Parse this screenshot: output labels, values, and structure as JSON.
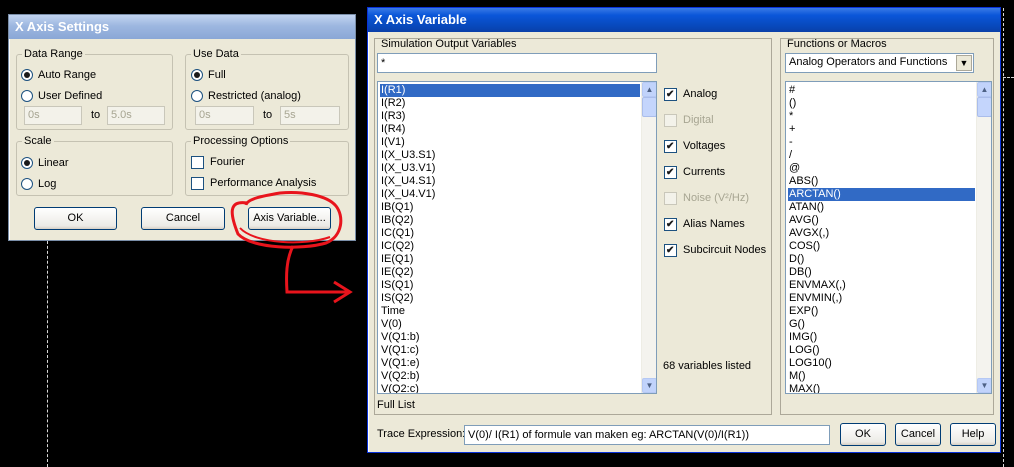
{
  "axis_settings": {
    "title": "X Axis Settings",
    "data_range": {
      "legend": "Data Range",
      "auto_label": "Auto Range",
      "user_label": "User Defined",
      "from_value": "0s",
      "to_label": "to",
      "to_value": "5.0s"
    },
    "use_data": {
      "legend": "Use Data",
      "full_label": "Full",
      "restricted_label": "Restricted (analog)",
      "from_value": "0s",
      "to_label": "to",
      "to_value": "5s"
    },
    "scale": {
      "legend": "Scale",
      "linear_label": "Linear",
      "log_label": "Log"
    },
    "processing": {
      "legend": "Processing Options",
      "fourier_label": "Fourier",
      "perf_label": "Performance Analysis"
    },
    "ok_label": "OK",
    "cancel_label": "Cancel",
    "axis_variable_label": "Axis Variable..."
  },
  "axis_variable": {
    "title": "X Axis Variable",
    "sim_output_label": "Simulation Output Variables",
    "filter_value": "*",
    "variables": [
      "I(R1)",
      "I(R2)",
      "I(R3)",
      "I(R4)",
      "I(V1)",
      "I(X_U3.S1)",
      "I(X_U3.V1)",
      "I(X_U4.S1)",
      "I(X_U4.V1)",
      "IB(Q1)",
      "IB(Q2)",
      "IC(Q1)",
      "IC(Q2)",
      "IE(Q1)",
      "IE(Q2)",
      "IS(Q1)",
      "IS(Q2)",
      "Time",
      "V(0)",
      "V(Q1:b)",
      "V(Q1:c)",
      "V(Q1:e)",
      "V(Q2:b)",
      "V(Q2:c)"
    ],
    "selected_variable": "I(R1)",
    "checkboxes": {
      "analog": "Analog",
      "digital": "Digital",
      "voltages": "Voltages",
      "currents": "Currents",
      "noise": "Noise (V²/Hz)",
      "alias": "Alias Names",
      "subcircuit": "Subcircuit Nodes"
    },
    "variables_count": "68 variables listed",
    "full_list_label": "Full List",
    "functions_label": "Functions or Macros",
    "functions_selected": "Analog Operators and Functions",
    "functions": [
      "#",
      "()",
      "*",
      "+",
      "-",
      "/",
      "@",
      "ABS()",
      "ARCTAN()",
      "ATAN()",
      "AVG()",
      "AVGX(,)",
      "COS()",
      "D()",
      "DB()",
      "ENVMAX(,)",
      "ENVMIN(,)",
      "EXP()",
      "G()",
      "IMG()",
      "LOG()",
      "LOG10()",
      "M()",
      "MAX()"
    ],
    "selected_function": "ARCTAN()",
    "trace_label": "Trace Expression:",
    "trace_value": "V(0)/ I(R1) of formule van maken eg:  ARCTAN(V(0)/I(R1))",
    "ok_label": "OK",
    "cancel_label": "Cancel",
    "help_label": "Help"
  },
  "colors": {
    "annotation": "#e8141c",
    "selection": "#316ac5",
    "title_active": "#0a56d9"
  }
}
